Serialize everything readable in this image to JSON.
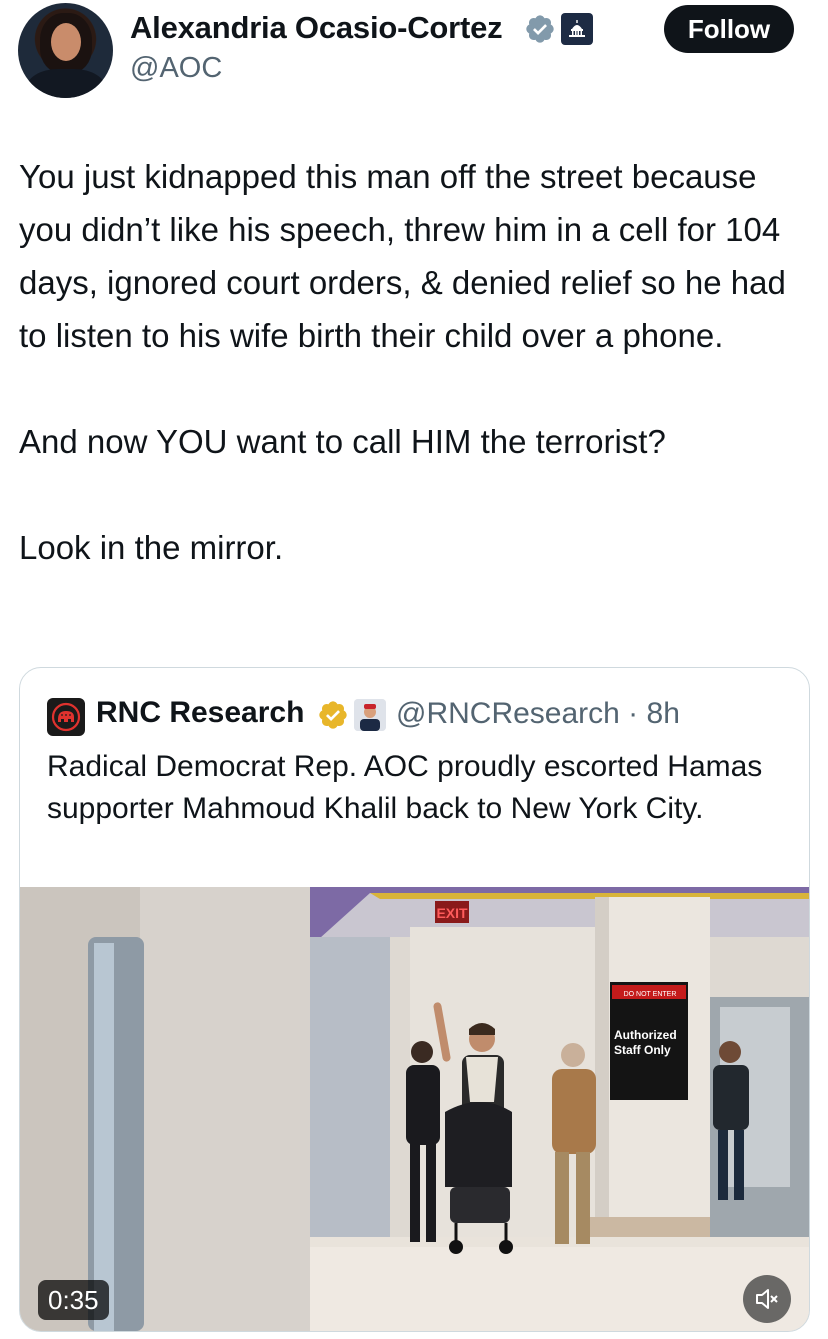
{
  "author": {
    "display_name": "Alexandria Ocasio-Cortez",
    "handle": "@AOC",
    "verified_icon": "verified-badge-gray-icon",
    "affiliation_icon": "capitol-dome-icon"
  },
  "follow_button": {
    "label": "Follow"
  },
  "tweet": {
    "paragraphs": [
      "You just kidnapped this man off the street because you didn’t like his speech, threw him in a cell for 104 days, ignored court orders, & denied relief so he had to listen to his wife birth their child over a phone.",
      "And now YOU want to call HIM the terrorist?",
      "Look in the mirror."
    ]
  },
  "quoted_tweet": {
    "display_name": "RNC Research",
    "handle_time": "@RNCResearch · 8h",
    "text": "Radical Democrat Rep. AOC proudly escorted Hamas supporter Mahmoud Khalil back to New York City.",
    "logo_icon": "gop-elephant-icon",
    "verified_icon": "verified-badge-gold-icon",
    "media": {
      "duration": "0:35",
      "mute_icon": "speaker-muted-icon",
      "signs": {
        "exit": "EXIT",
        "do_not_enter": "DO NOT ENTER",
        "authorized_line1": "Authorized",
        "authorized_line2": "Staff Only"
      }
    }
  },
  "colors": {
    "text_primary": "#0f1419",
    "text_secondary": "#536471",
    "border": "#cfd9de",
    "follow_bg": "#0f1419",
    "gold_badge": "#e8b62a",
    "gray_badge": "#829aab"
  }
}
